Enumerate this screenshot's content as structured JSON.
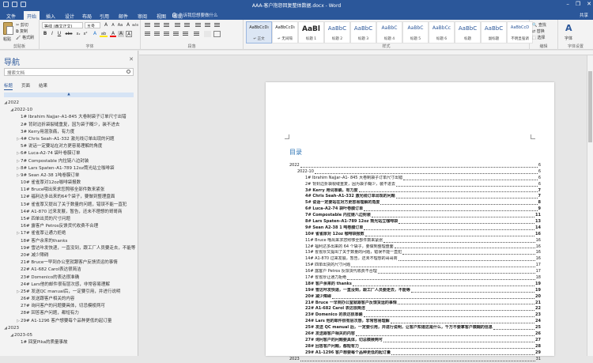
{
  "window": {
    "doc_title": "AAA-客户抱怨回复整体数据.docx - Word",
    "minimize": "–",
    "restore": "❐",
    "close": "✕"
  },
  "ribbon_tabs": [
    "文件",
    "开始",
    "插入",
    "设计",
    "布局",
    "引用",
    "邮件",
    "审阅",
    "视图",
    "帮助"
  ],
  "active_tab_index": 1,
  "tell_me": "告诉我您想要做什么",
  "account": "共享",
  "clipboard": {
    "paste": "粘贴",
    "cut": "剪切",
    "copy": "复制",
    "format_painter": "格式刷",
    "group": "剪贴板"
  },
  "font": {
    "name": "等线 (西文正文)",
    "size": "五号",
    "grow": "A",
    "shrink": "A",
    "case": "Aa",
    "clear": "A",
    "pinyin": "wén",
    "bold": "B",
    "italic": "I",
    "underline": "U",
    "strike": "abc",
    "sub": "x₂",
    "sup": "x²",
    "effects": "A",
    "highlight": "ab",
    "color": "A",
    "shade": "A",
    "border": "A",
    "group": "字体"
  },
  "paragraph": {
    "group": "段落"
  },
  "styles": {
    "group": "样式",
    "items": [
      {
        "sample": "AaBbCcDı",
        "name": "↵ 正文"
      },
      {
        "sample": "AaBbCcDı",
        "name": "↵ 无间隔"
      },
      {
        "sample": "AaBl",
        "name": "标题 1"
      },
      {
        "sample": "AaBbC",
        "name": "标题 2"
      },
      {
        "sample": "AaBbC",
        "name": "标题 3"
      },
      {
        "sample": "AaBbC",
        "name": "标题 4"
      },
      {
        "sample": "AaBbC",
        "name": "标题 5"
      },
      {
        "sample": "AaBbCc",
        "name": "标题 6"
      },
      {
        "sample": "AaBbC",
        "name": "标题"
      },
      {
        "sample": "AaBbC",
        "name": "副标题"
      },
      {
        "sample": "AaBbCcD",
        "name": "不明显强调"
      }
    ]
  },
  "editing": {
    "find": "查找",
    "replace": "替换",
    "select": "选择",
    "group": "编辑"
  },
  "font_family_btn": {
    "label": "字体",
    "group": "字体设置"
  },
  "nav": {
    "title": "导航",
    "close": "✕",
    "search_placeholder": "搜索文档",
    "tabs": [
      "标题",
      "页面",
      "结果"
    ],
    "scroll_up": "▲",
    "items": [
      {
        "level": 0,
        "twisty": "◢",
        "text": "2022"
      },
      {
        "level": 1,
        "twisty": "◢",
        "text": "2022-10"
      },
      {
        "level": 2,
        "twisty": "",
        "text": "1# Ibrahim Najjar–A1-845 大卷制袋子订单尺寸出错"
      },
      {
        "level": 2,
        "twisty": "",
        "text": "2# 背封边折袋裂缝重复，因为袋子糊少，装不进去"
      },
      {
        "level": 2,
        "twisty": "",
        "text": "3# Kerry用混涨痛，有力度"
      },
      {
        "level": 2,
        "twisty": "▷",
        "text": "4# Chris Seah–A1-332 激光线订单出现的问题"
      },
      {
        "level": 2,
        "twisty": "",
        "text": "5# 说话一定要站在对方更容易理解的角度"
      },
      {
        "level": 2,
        "twisty": "▷",
        "text": "6# Luca-A2-74 袋叶卷膜订单"
      },
      {
        "level": 2,
        "twisty": "▷",
        "text": "7# Compostable 内拉链八边封装"
      },
      {
        "level": 2,
        "twisty": "▷",
        "text": "8# Lars Spaten–A1-789 12oz筒光站立咖啡袋"
      },
      {
        "level": 2,
        "twisty": "▷",
        "text": "9# Sean A2-38 1吨卷膜订单"
      },
      {
        "level": 2,
        "twisty": "",
        "text": "10# 雀雀厚对12oz咖啡袋报数"
      },
      {
        "level": 2,
        "twisty": "",
        "text": "11# Bruce哦出来求您照够全部件数来紧张"
      },
      {
        "level": 2,
        "twisty": "",
        "text": "12# 福利达多出来的64个袋子，要做到整理盘面"
      },
      {
        "level": 2,
        "twisty": "",
        "text": "13# 雀雀厚又提出了关于数量的问题，错误不能一直犯"
      },
      {
        "level": 2,
        "twisty": "",
        "text": "14# A1-870 过来发展，暂告，还未不理想的哥哥商"
      },
      {
        "level": 2,
        "twisty": "",
        "text": "15# 四单出货的尺寸问题"
      },
      {
        "level": 2,
        "twisty": "",
        "text": "16# 露客户 Petros反馈货代收费不合理"
      },
      {
        "level": 2,
        "twisty": "▷",
        "text": "17# 雀雀厚让通力拒绝"
      },
      {
        "level": 2,
        "twisty": "",
        "text": "18# 客户余来的thanks"
      },
      {
        "level": 2,
        "twisty": "",
        "text": "19# 雪达咔发快递，一直没到，跟工厂人员要走去，不能等"
      },
      {
        "level": 2,
        "twisty": "",
        "text": "20# 减少障碍"
      },
      {
        "level": 2,
        "twisty": "",
        "text": "21# Bruce一早到办公室就跟客户反馈货运的事情"
      },
      {
        "level": 2,
        "twisty": "",
        "text": "22# A1-682 Carol表达很简洁"
      },
      {
        "level": 2,
        "twisty": "",
        "text": "23# Domenico的表达很准确"
      },
      {
        "level": 2,
        "twisty": "",
        "text": "24# Lars他的邮件很有层次感，非常容易理解"
      },
      {
        "level": 2,
        "twisty": "▷",
        "text": "25# 发送QC manual后，一定要引用，并进行说明"
      },
      {
        "level": 2,
        "twisty": "",
        "text": "26# 发送跟客户相关的内容"
      },
      {
        "level": 2,
        "twisty": "",
        "text": "27# 询问客户的问题要具体，切忌模棱两可"
      },
      {
        "level": 2,
        "twisty": "",
        "text": "28# 回答客户问题，都短有力"
      },
      {
        "level": 2,
        "twisty": "▷",
        "text": "29# A1-1296 客户想要每个品种更低的起订量"
      },
      {
        "level": 0,
        "twisty": "◢",
        "text": "2023"
      },
      {
        "level": 1,
        "twisty": "◢",
        "text": "2023-05"
      },
      {
        "level": 2,
        "twisty": "",
        "text": "1# 回复Pika的质量事故"
      }
    ]
  },
  "toc": {
    "heading": "目录",
    "entries": [
      {
        "indent": 0,
        "bold": false,
        "text": "2022",
        "page": "6"
      },
      {
        "indent": 1,
        "bold": false,
        "text": "2022-10",
        "page": "6"
      },
      {
        "indent": 2,
        "bold": false,
        "text": "1# Ibrahim Najjar–A1- 845 大卷制袋子订单尺寸出错",
        "page": "6"
      },
      {
        "indent": 2,
        "bold": false,
        "text": "2# 背封边折袋裂缝重复，因为袋子糊少，装不进去",
        "page": "6"
      },
      {
        "indent": 2,
        "bold": true,
        "text": "3# Kerry 用词准确，有力度",
        "page": "7"
      },
      {
        "indent": 2,
        "bold": true,
        "text": "4# Chris Seah–A1-332 激光线订单出现的问题",
        "page": "7"
      },
      {
        "indent": 2,
        "bold": true,
        "text": "5# 说话一定要站在对方更容易理解的角度",
        "page": "8"
      },
      {
        "indent": 2,
        "bold": true,
        "text": "6# Luca–A2-74 袋叶卷膜订单",
        "page": "9"
      },
      {
        "indent": 2,
        "bold": true,
        "text": "7# Compostable 内拉链八边封装",
        "page": "11"
      },
      {
        "indent": 2,
        "bold": true,
        "text": "8# Lars Spaten–A1-789 12oz 筒光站立咖啡袋",
        "page": "13"
      },
      {
        "indent": 2,
        "bold": true,
        "text": "9# Sean A2-38 1 吨卷膜订单",
        "page": "14"
      },
      {
        "indent": 2,
        "bold": true,
        "text": "10# 雀雀厚对 12oz 咖啡袋报数",
        "page": "16"
      },
      {
        "indent": 2,
        "bold": false,
        "text": "11# Bruce 哦出来求您照够全部件数来紧张",
        "page": "16"
      },
      {
        "indent": 2,
        "bold": false,
        "text": "12# 福利达多出来的 64 个袋子，要做到整理盘面",
        "page": "16"
      },
      {
        "indent": 2,
        "bold": false,
        "text": "13# 雀雀厚又提出了关于数量的问题，错误不能一直犯",
        "page": "16"
      },
      {
        "indent": 2,
        "bold": false,
        "text": "14# A1-870 过来发展，暂告，还未不理想的哥哥商",
        "page": "16"
      },
      {
        "indent": 2,
        "bold": false,
        "text": "15# 四单出货的尺寸问题",
        "page": "17"
      },
      {
        "indent": 2,
        "bold": false,
        "text": "16# 露客户 Petros 反馈货代收费不合理",
        "page": "17"
      },
      {
        "indent": 2,
        "bold": false,
        "text": "17# 雀雀厚让通力拒绝",
        "page": "18"
      },
      {
        "indent": 2,
        "bold": true,
        "text": "18# 客户余来的 thanks",
        "page": "19"
      },
      {
        "indent": 2,
        "bold": true,
        "text": "19# 雪达咔发快递，一直没到，跟工厂人员要走去，不能等",
        "page": "19"
      },
      {
        "indent": 2,
        "bold": true,
        "text": "20# 减少障碍",
        "page": "20"
      },
      {
        "indent": 2,
        "bold": true,
        "text": "21# Bruce 一早到办公室就跟客户反馈货运的事情",
        "page": "21"
      },
      {
        "indent": 2,
        "bold": true,
        "text": "22# A1-682 Carol 表达很简洁",
        "page": "22"
      },
      {
        "indent": 2,
        "bold": true,
        "text": "23# Domenico 的表达很准确",
        "page": "23"
      },
      {
        "indent": 2,
        "bold": true,
        "text": "24# Lars 他的邮件很有层次感，非常容易理解",
        "page": "24"
      },
      {
        "indent": 2,
        "bold": true,
        "text": "25# 发送 QC manual 后，一定要引用，并进行说明，让客户知道这是什么，千万不要拿客户模糊的信息",
        "page": "25"
      },
      {
        "indent": 2,
        "bold": true,
        "text": "26# 发送跟客户相关的内容",
        "page": "26"
      },
      {
        "indent": 2,
        "bold": true,
        "text": "27# 询问客户的问题要具体，切忌模棱两可",
        "page": "27"
      },
      {
        "indent": 2,
        "bold": true,
        "text": "28# 回答客户问题，都短有力",
        "page": "28"
      },
      {
        "indent": 2,
        "bold": true,
        "text": "29# A1-1296 客户想要每个品种更低的起订量",
        "page": "29"
      },
      {
        "indent": 0,
        "bold": false,
        "text": "2023",
        "page": "31"
      }
    ]
  },
  "colors": {
    "brand": "#2b579a",
    "toc_heading": "#2e74b5"
  }
}
